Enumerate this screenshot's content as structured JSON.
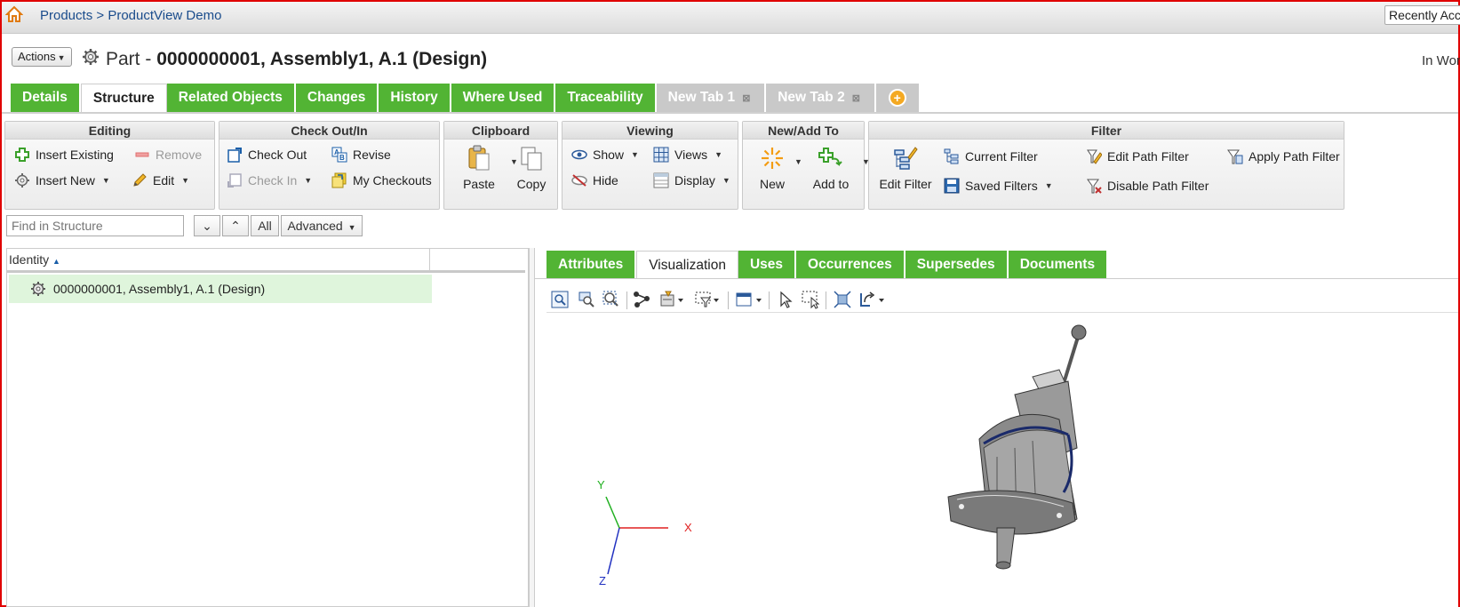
{
  "topbar": {
    "breadcrumb_products": "Products",
    "breadcrumb_sep": ">",
    "breadcrumb_current": "ProductView Demo",
    "recent_label": "Recently Accessed"
  },
  "header": {
    "actions_label": "Actions",
    "part_prefix": "Part -",
    "part_name": "0000000001, Assembly1, A.1 (Design)",
    "workspace_label": "In Work"
  },
  "main_tabs": [
    {
      "label": "Details"
    },
    {
      "label": "Structure"
    },
    {
      "label": "Related Objects"
    },
    {
      "label": "Changes"
    },
    {
      "label": "History"
    },
    {
      "label": "Where Used"
    },
    {
      "label": "Traceability"
    },
    {
      "label": "New Tab 1"
    },
    {
      "label": "New Tab 2"
    }
  ],
  "toolbar": {
    "editing": {
      "title": "Editing",
      "insert_existing": "Insert Existing",
      "remove": "Remove",
      "insert_new": "Insert New",
      "edit": "Edit"
    },
    "checkout": {
      "title": "Check Out/In",
      "check_out": "Check Out",
      "revise": "Revise",
      "check_in": "Check In",
      "my_checkouts": "My Checkouts"
    },
    "clipboard": {
      "title": "Clipboard",
      "paste": "Paste",
      "copy": "Copy"
    },
    "viewing": {
      "title": "Viewing",
      "show": "Show",
      "views": "Views",
      "hide": "Hide",
      "display": "Display"
    },
    "newadd": {
      "title": "New/Add To",
      "new": "New",
      "add_to": "Add to"
    },
    "filter": {
      "title": "Filter",
      "edit_filter": "Edit Filter",
      "current_filter": "Current Filter",
      "edit_path_filter": "Edit Path Filter",
      "apply_path_filter": "Apply Path Filter",
      "saved_filters": "Saved Filters",
      "disable_path_filter": "Disable Path Filter"
    }
  },
  "find": {
    "placeholder": "Find in Structure",
    "all_label": "All",
    "advanced_label": "Advanced"
  },
  "tree": {
    "identity_header": "Identity",
    "row_label": "0000000001, Assembly1, A.1 (Design)"
  },
  "sub_tabs": [
    {
      "label": "Attributes"
    },
    {
      "label": "Visualization"
    },
    {
      "label": "Uses"
    },
    {
      "label": "Occurrences"
    },
    {
      "label": "Supersedes"
    },
    {
      "label": "Documents"
    }
  ],
  "viewer": {
    "axis_y": "Y",
    "axis_x": "X",
    "axis_z": "Z",
    "color_x": "#e02020",
    "color_y": "#20b020",
    "color_z": "#2030c0"
  },
  "colors": {
    "tab_green": "#52b434",
    "tab_gray": "#c9c9c9",
    "link_blue": "#1a4c8c",
    "selected_row": "#dff5dc"
  }
}
